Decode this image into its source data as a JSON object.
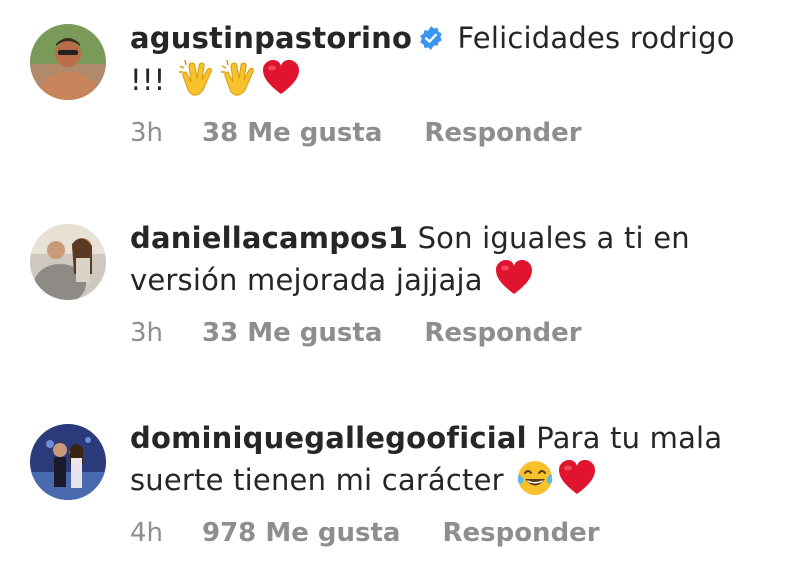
{
  "comments": [
    {
      "username": "agustinpastorino",
      "verified": true,
      "text": "Felicidades rodrigo !!!",
      "emojis": [
        "clapping-hands",
        "clapping-hands",
        "red-heart"
      ],
      "time": "3h",
      "likes": "38 Me gusta",
      "reply": "Responder"
    },
    {
      "username": "daniellacampos1",
      "verified": false,
      "text": "Son iguales a ti en versión mejorada jajjaja",
      "emojis": [
        "red-heart"
      ],
      "time": "3h",
      "likes": "33 Me gusta",
      "reply": "Responder"
    },
    {
      "username": "dominiquegallegooficial",
      "verified": false,
      "text": "Para tu mala suerte tienen mi carácter",
      "emojis": [
        "tears-of-joy",
        "red-heart"
      ],
      "time": "4h",
      "likes": "978 Me gusta",
      "reply": "Responder"
    }
  ],
  "colors": {
    "text": "#262626",
    "meta": "#8e8e8e",
    "verified": "#3897f0",
    "heart": "#e0142f",
    "emoji_yellow": "#f7c22b"
  }
}
